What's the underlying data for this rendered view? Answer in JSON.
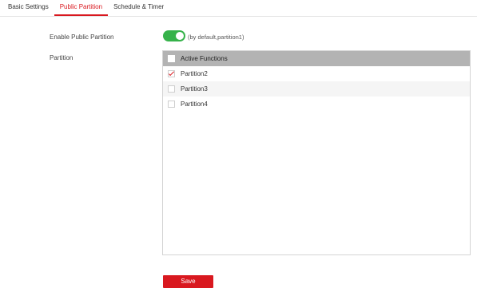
{
  "tabs": [
    {
      "label": "Basic Settings",
      "active": false
    },
    {
      "label": "Public Partition",
      "active": true
    },
    {
      "label": "Schedule & Timer",
      "active": false
    }
  ],
  "form": {
    "enable_label": "Enable Public Partition",
    "enable_value": true,
    "enable_hint": "(by default,partition1)",
    "partition_label": "Partition"
  },
  "partition_list": {
    "header": "Active Functions",
    "header_checked": false,
    "rows": [
      {
        "label": "Partition2",
        "checked": true
      },
      {
        "label": "Partition3",
        "checked": false
      },
      {
        "label": "Partition4",
        "checked": false
      }
    ]
  },
  "actions": {
    "save_label": "Save"
  },
  "colors": {
    "accent": "#d9181f",
    "toggle_on": "#36b24a",
    "header_bg": "#b3b3b3"
  }
}
